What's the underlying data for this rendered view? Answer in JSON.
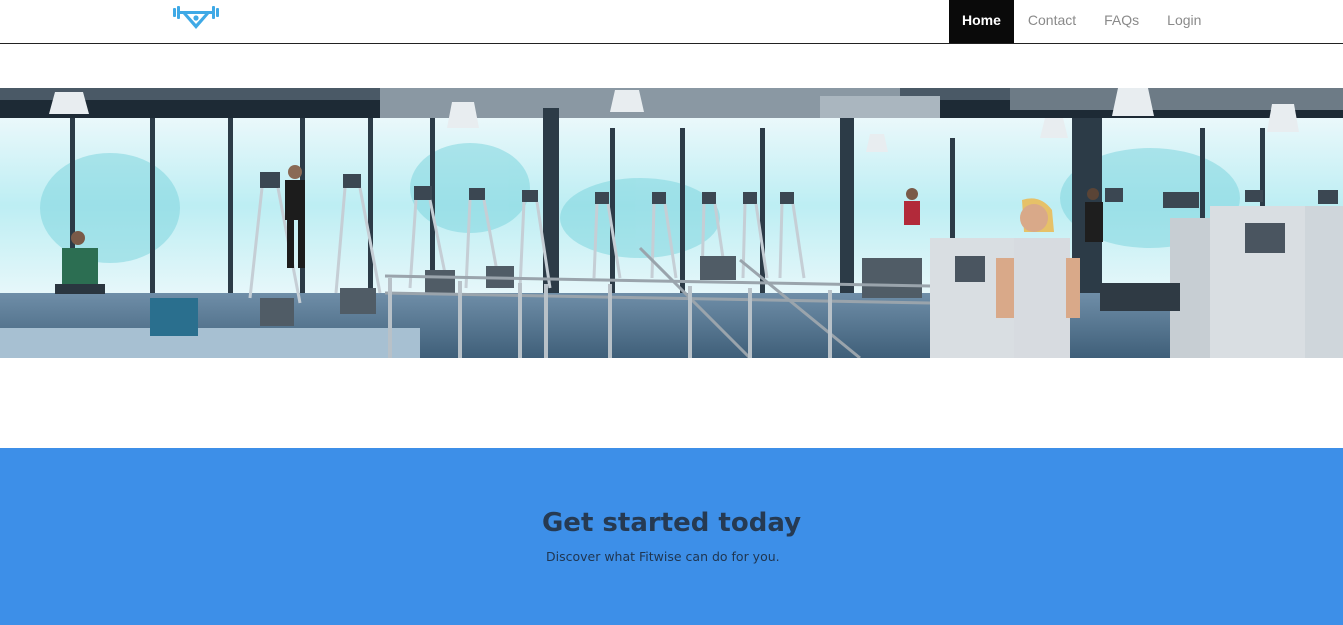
{
  "nav": {
    "items": [
      {
        "label": "Home",
        "active": true
      },
      {
        "label": "Contact",
        "active": false
      },
      {
        "label": "FAQs",
        "active": false
      },
      {
        "label": "Login",
        "active": false
      }
    ]
  },
  "logo": {
    "icon": "barbell-person-icon",
    "color": "#3fa9e6"
  },
  "hero": {
    "image": "gym-interior-photo"
  },
  "cta": {
    "title": "Get started today",
    "subtitle": "Discover what Fitwise can do for you.",
    "background": "#3d8fe8"
  }
}
